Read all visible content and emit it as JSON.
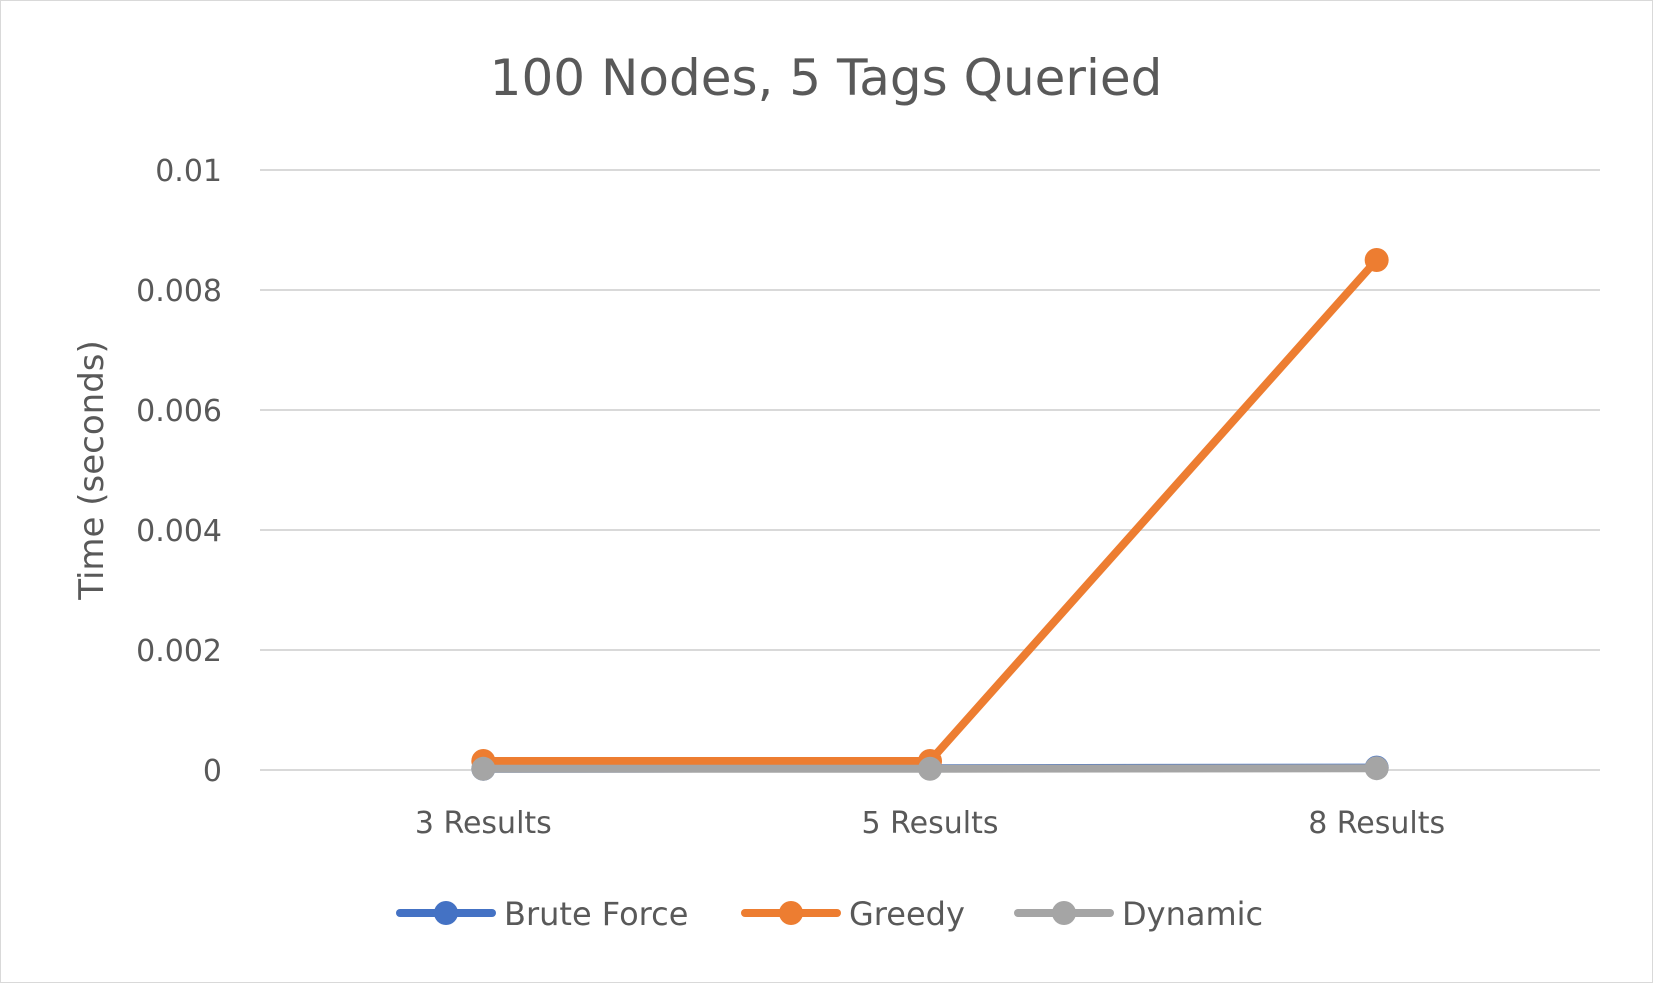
{
  "chart_data": {
    "type": "line",
    "title": "100 Nodes, 5 Tags Queried",
    "xlabel": "",
    "ylabel": "Time (seconds)",
    "categories": [
      "3 Results",
      "5 Results",
      "8 Results"
    ],
    "ylim": [
      0,
      0.01
    ],
    "yticks": [
      0,
      0.002,
      0.004,
      0.006,
      0.008,
      0.01
    ],
    "ytick_labels": [
      "0",
      "0.002",
      "0.004",
      "0.006",
      "0.008",
      "0.01"
    ],
    "grid": true,
    "legend_position": "bottom",
    "series": [
      {
        "name": "Brute Force",
        "color": "#4472c4",
        "values": [
          2e-05,
          3e-05,
          4e-05
        ]
      },
      {
        "name": "Greedy",
        "color": "#ed7d31",
        "values": [
          0.00015,
          0.00015,
          0.0085
        ]
      },
      {
        "name": "Dynamic",
        "color": "#a5a5a5",
        "values": [
          2e-05,
          2e-05,
          3e-05
        ]
      }
    ]
  }
}
